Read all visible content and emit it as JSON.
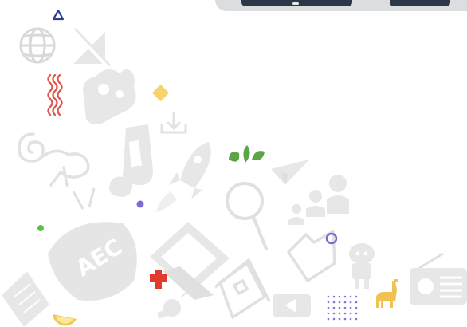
{
  "colors": {
    "background": "#ffffff",
    "doodle": "#e7e7e7",
    "doodle_outline": "#d9d9d9",
    "topbar": "#dcdddf",
    "topbar_button": "#2c3748",
    "triangle_blue": "#2b3f8c",
    "squiggle_red": "#e0524a",
    "diamond_yellow": "#f6d36b",
    "leaf_green": "#5aa545",
    "dot_purple": "#7c6bd6",
    "dot_green": "#5bc04a",
    "ring_purple": "#7a6bd0",
    "cross_red": "#e23b2e",
    "lemon_yellow": "#f2c94c",
    "llama_yellow": "#f0c24f",
    "dots_purple": "#8b72d8"
  },
  "illustrations": {
    "tv_label": "AEC"
  },
  "icons": [
    "globe-icon",
    "no-signal-icon",
    "sign-language-hand-icon",
    "download-icon",
    "monkey-icon",
    "music-note-icon",
    "rocket-icon",
    "magnifier-icon",
    "paper-plane-icon",
    "people-icon",
    "tv-icon",
    "laptop-icon",
    "house-icon",
    "folder-icon",
    "play-button-icon",
    "lightbulb-icon",
    "robot-icon",
    "radio-icon",
    "notebook-icon",
    "llama-icon",
    "lemon-icon"
  ]
}
